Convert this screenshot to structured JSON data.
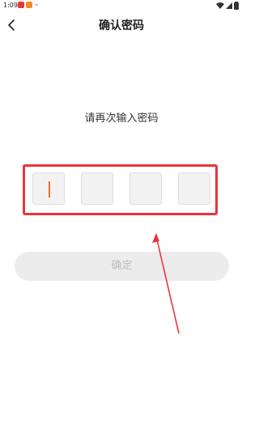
{
  "status_bar": {
    "time": "1:09"
  },
  "header": {
    "title": "确认密码",
    "back_icon": "chevron-left-icon"
  },
  "prompt": {
    "text": "请再次输入密码"
  },
  "pin_input": {
    "length": 4,
    "filled": 0,
    "cursor_color": "#f26a21"
  },
  "confirm": {
    "label": "确定"
  },
  "colors": {
    "annotation_red": "#e8353b",
    "button_bg": "#ececec",
    "button_text": "#bdbdbd"
  }
}
